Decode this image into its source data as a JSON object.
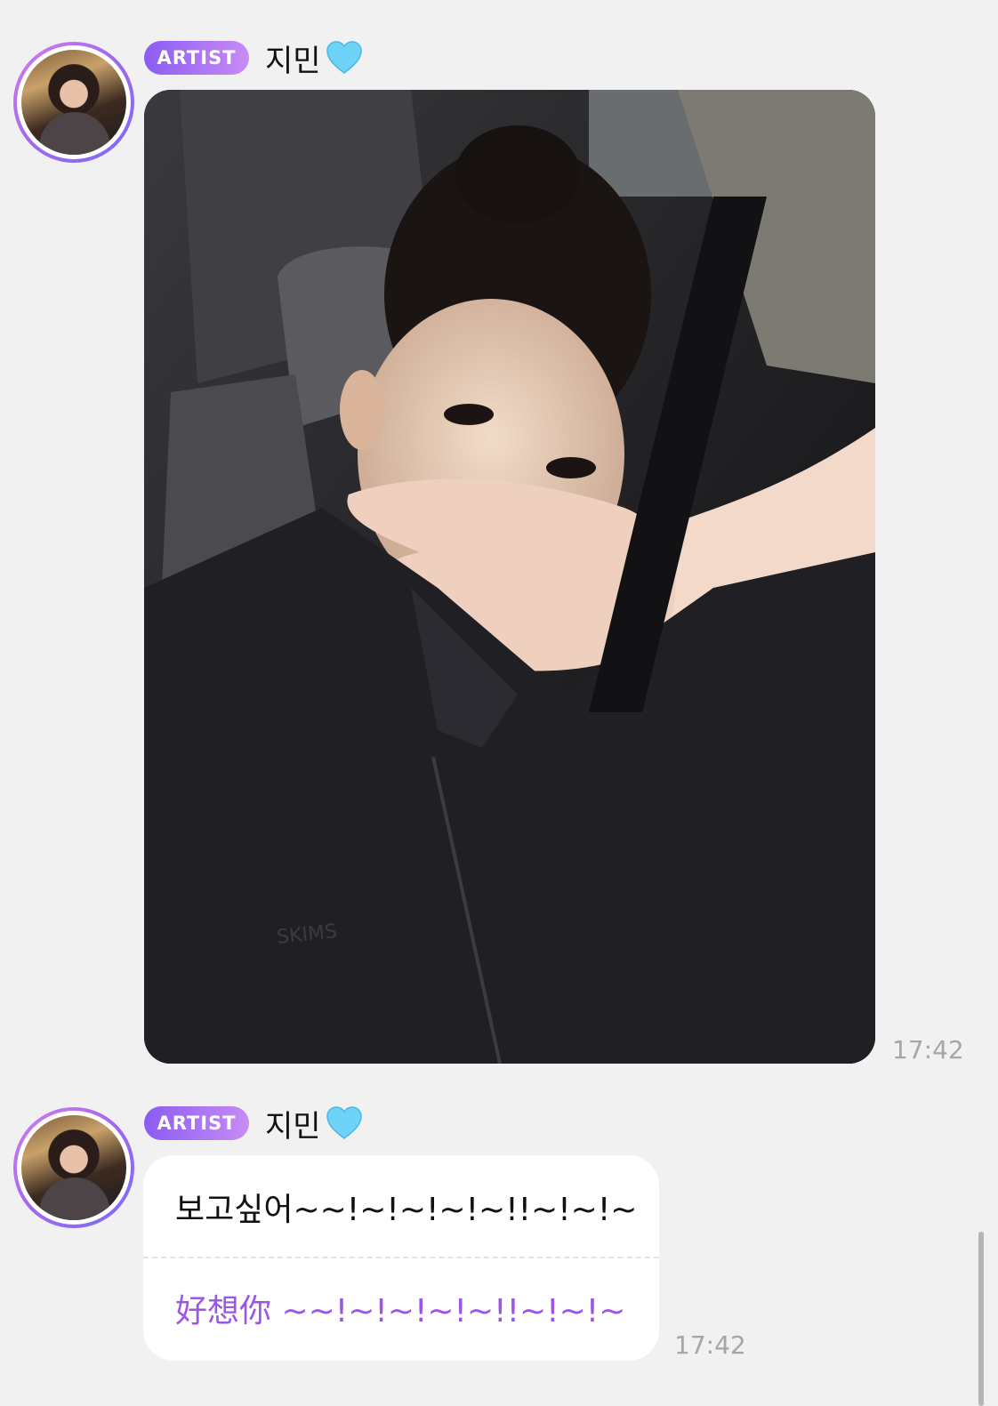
{
  "messages": [
    {
      "badge": "ARTIST",
      "name": "지민",
      "name_icon": "light-blue-heart-icon",
      "type": "photo",
      "time": "17:42"
    },
    {
      "badge": "ARTIST",
      "name": "지민",
      "name_icon": "light-blue-heart-icon",
      "type": "text",
      "original_text": "보고싶어~~!~!~!~!~!!~!~!~",
      "translated_text": "好想你 ~~!~!~!~!~!!~!~!~",
      "time": "17:42"
    }
  ],
  "colors": {
    "background": "#f1f1f1",
    "badge_gradient_start": "#8a5cf3",
    "badge_gradient_end": "#c98cf4",
    "translation_text": "#9b55e8",
    "timestamp": "#a6a6a6",
    "heart": "#6fd3f7"
  }
}
